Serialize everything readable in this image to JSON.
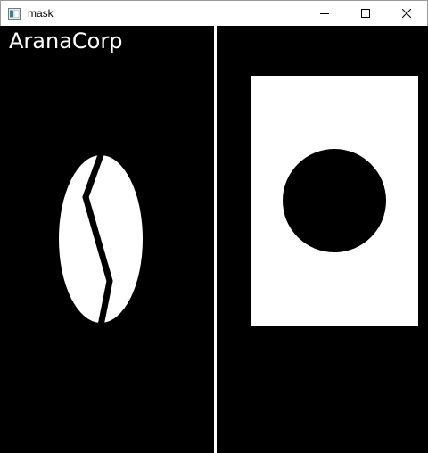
{
  "window": {
    "title": "mask",
    "icons": {
      "app": "app-icon",
      "minimize": "minimize-icon",
      "maximize": "maximize-icon",
      "close": "close-icon"
    }
  },
  "left_panel": {
    "brand_text": "AranaCorp",
    "shape": "coffee-bean-mask"
  },
  "right_panel": {
    "shape": "white-rectangle-with-black-circle-mask"
  },
  "colors": {
    "background": "#000000",
    "foreground": "#ffffff",
    "titlebar": "#ffffff"
  }
}
